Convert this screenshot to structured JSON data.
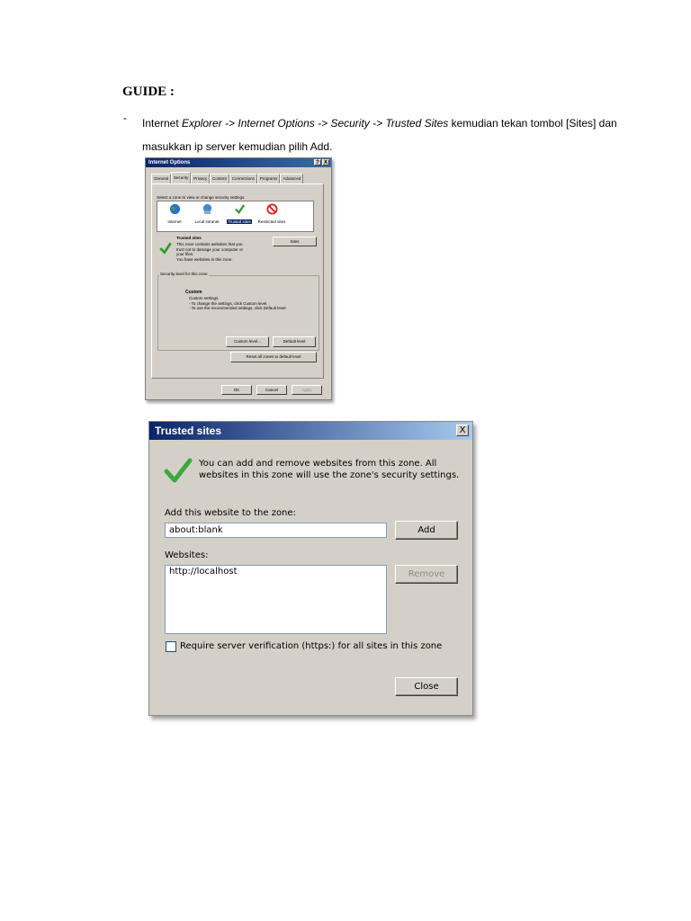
{
  "guide": {
    "title": "GUIDE :",
    "bullet": "-",
    "line": {
      "part1": "Internet ",
      "ital1": "Explorer -> Internet Options -> Security -> Trusted Sites",
      "part2": " kemudian tekan tombol [Sites] dan masukkan ip server kemudian pilih Add."
    }
  },
  "internet_options": {
    "title": "Internet Options",
    "help_btn": "?",
    "close_btn": "X",
    "tabs": [
      "General",
      "Security",
      "Privacy",
      "Content",
      "Connections",
      "Programs",
      "Advanced"
    ],
    "active_tab": "Security",
    "zone_prompt": "Select a zone to view or change security settings.",
    "zones": [
      {
        "label": "Internet",
        "icon": "globe-icon"
      },
      {
        "label": "Local intranet",
        "icon": "intranet-icon"
      },
      {
        "label": "Trusted sites",
        "icon": "checkmark-icon"
      },
      {
        "label": "Restricted sites",
        "icon": "no-entry-icon"
      }
    ],
    "selected_zone": "Trusted sites",
    "zone_heading": "Trusted sites",
    "zone_desc": [
      "This zone contains websites that you",
      "trust not to damage your computer or",
      "your files.",
      "You have websites in this zone."
    ],
    "sites_btn": "Sites",
    "security_level_label": "Security level for this zone",
    "custom_heading": "Custom",
    "custom_lines": [
      "Custom settings.",
      "- To change the settings, click Custom level.",
      "- To use the recommended settings, click Default level."
    ],
    "custom_level_btn": "Custom level...",
    "default_level_btn": "Default level",
    "reset_btn": "Reset all zones to default level",
    "ok_btn": "OK",
    "cancel_btn": "Cancel",
    "apply_btn": "Apply"
  },
  "trusted_sites": {
    "title": "Trusted sites",
    "close_btn": "X",
    "description": "You can add and remove websites from this zone. All websites in this zone will use the zone's security settings.",
    "add_label": "Add this website to the zone:",
    "add_value": "about:blank",
    "add_btn": "Add",
    "websites_label": "Websites:",
    "websites": [
      "http://localhost"
    ],
    "remove_btn": "Remove",
    "require_https_label": "Require server verification (https:) for all sites in this zone",
    "close_label": "Close"
  }
}
